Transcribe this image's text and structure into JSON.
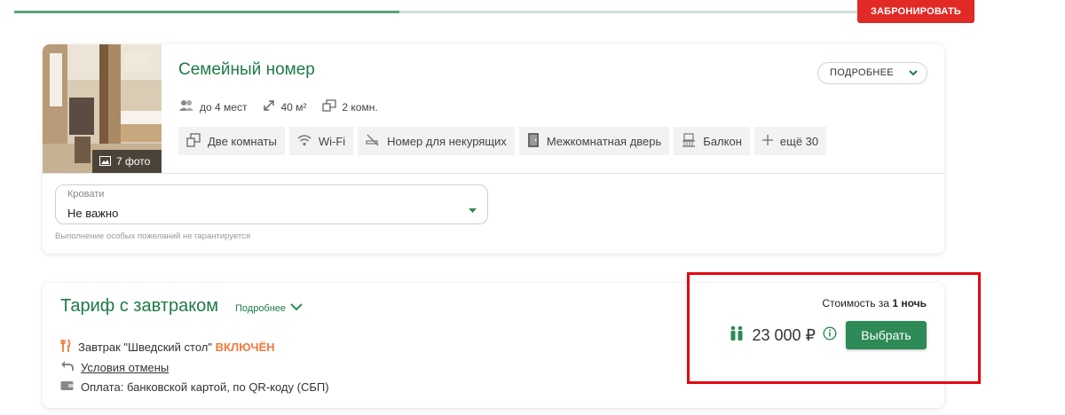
{
  "header": {
    "progress_fraction": 0.43,
    "book_label": "ЗАБРОНИРОВАТЬ"
  },
  "room": {
    "title": "Семейный номер",
    "details_label": "ПОДРОБНЕЕ",
    "photo_count_label": "7 фото",
    "specs": {
      "guests": "до 4 мест",
      "area": "40 м²",
      "rooms": "2 комн."
    },
    "amenities": [
      {
        "label": "Две комнаты",
        "icon": "two-rooms-icon"
      },
      {
        "label": "Wi-Fi",
        "icon": "wifi-icon"
      },
      {
        "label": "Номер для некурящих",
        "icon": "no-smoking-icon"
      },
      {
        "label": "Межкомнатная дверь",
        "icon": "door-icon"
      },
      {
        "label": "Балкон",
        "icon": "balcony-icon"
      },
      {
        "label": "ещё 30",
        "icon": "plus-icon"
      }
    ],
    "beds": {
      "label": "Кровати",
      "value": "Не важно",
      "note": "Выполнение особых пожеланий не гарантируется"
    }
  },
  "tariff": {
    "title": "Тариф с завтраком",
    "more_label": "Подробнее",
    "breakfast_text": "Завтрак \"Шведский стол\"",
    "breakfast_status": "ВКЛЮЧЁН",
    "cancel_text": "Условия отмены",
    "payment_text": "Оплата: банковской картой, по QR-коду (СБП)",
    "cost_prefix": "Стоимость за",
    "cost_period": "1 ночь",
    "price": "23 000 ₽",
    "choose_label": "Выбрать"
  },
  "colors": {
    "brand_green": "#1f7a47",
    "button_green": "#2e8a57",
    "book_red": "#e12a26",
    "included_orange": "#f07a3c",
    "highlight_red": "#e30613"
  }
}
